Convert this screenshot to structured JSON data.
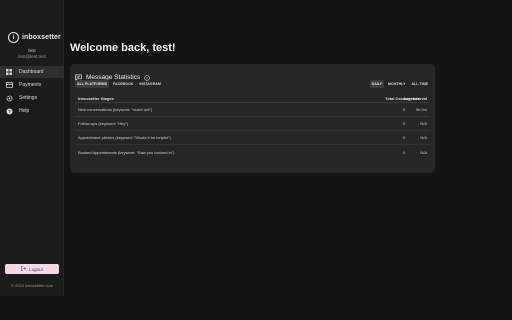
{
  "brand": {
    "name": "inboxsetter",
    "logo_letter": "i"
  },
  "user": {
    "name": "test",
    "email": "test@test.test"
  },
  "nav": [
    {
      "label": "Dashboard",
      "icon": "dashboard-grid-icon",
      "active": true
    },
    {
      "label": "Payments",
      "icon": "credit-card-icon",
      "active": false
    },
    {
      "label": "Settings",
      "icon": "gear-icon",
      "active": false
    },
    {
      "label": "Help",
      "icon": "help-circle-icon",
      "active": false
    }
  ],
  "logout": {
    "label": "Logout",
    "icon": "logout-icon"
  },
  "footer": {
    "copyright": "© 2024 inboxsetter.com"
  },
  "page": {
    "title": "Welcome back, test!"
  },
  "stats": {
    "title": "Message Statistics",
    "platform_filters": [
      "ALL PLATFORMS",
      "FACEBOOK",
      "INSTAGRAM"
    ],
    "active_platform": "ALL PLATFORMS",
    "periods": [
      "DAILY",
      "MONTHLY",
      "ALL TIME"
    ],
    "active_period": "DAILY",
    "columns": [
      "Inboxsetter Stages",
      "Total Occurrences",
      "Avg. Interval"
    ],
    "rows": [
      {
        "stage": "New conversations (keyword: \"reach out\")",
        "total": "0",
        "interval": "0h 0m"
      },
      {
        "stage": "Follow-ups (keyword: \"Hey\")",
        "total": "0",
        "interval": "N/A"
      },
      {
        "stage": "Appointment pitches (keyword: \"Would it be helpful\")",
        "total": "0",
        "interval": "N/A"
      },
      {
        "stage": "Booked Appointments (keyword: \"Saw you booked in\")",
        "total": "0",
        "interval": "N/A"
      }
    ]
  },
  "colors": {
    "background": "#141414",
    "sidebar": "#1b1b1b",
    "card": "#262626",
    "logout_bg": "#f4d8ea"
  }
}
